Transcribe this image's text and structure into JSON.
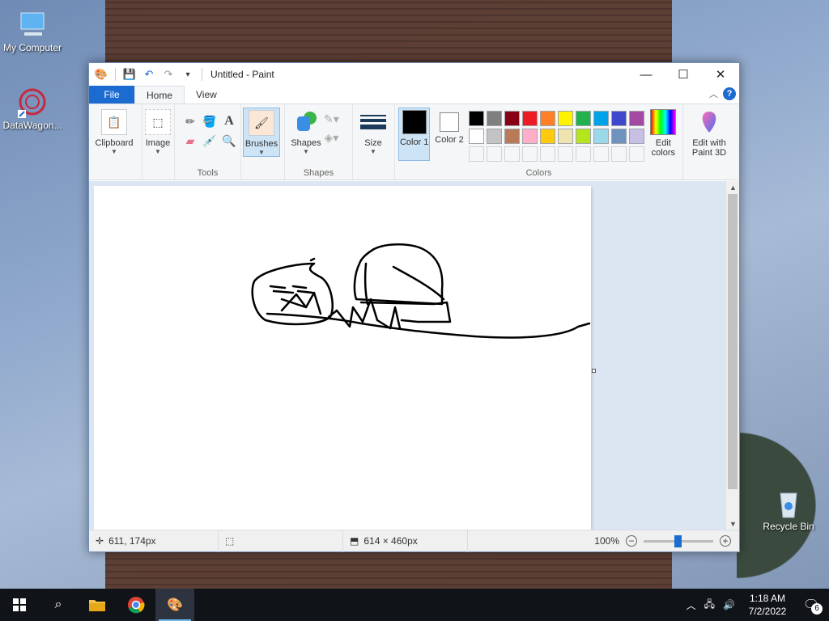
{
  "desktop": {
    "icons": [
      {
        "label": "My Computer"
      },
      {
        "label": "DataWagon..."
      },
      {
        "label": "Recycle Bin"
      }
    ]
  },
  "window": {
    "title": "Untitled - Paint",
    "controls": {
      "minimize": "—",
      "maximize": "☐",
      "close": "✕"
    }
  },
  "tabs": {
    "file": "File",
    "home": "Home",
    "view": "View"
  },
  "ribbon": {
    "clipboard": "Clipboard",
    "image": "Image",
    "tools_label": "Tools",
    "brushes": "Brushes",
    "shapes": "Shapes",
    "shapes_label": "Shapes",
    "size": "Size",
    "color1": "Color 1",
    "color2": "Color 2",
    "colors_label": "Colors",
    "edit_colors": "Edit colors",
    "edit_paint3d": "Edit with Paint 3D"
  },
  "palette": [
    "#000000",
    "#7f7f7f",
    "#880015",
    "#ed1c24",
    "#ff7f27",
    "#fff200",
    "#22b14c",
    "#00a2e8",
    "#3f48cc",
    "#a349a4",
    "#ffffff",
    "#c3c3c3",
    "#b97a57",
    "#ffaec9",
    "#ffc90e",
    "#efe4b0",
    "#b5e61d",
    "#99d9ea",
    "#7092be",
    "#c8bfe7"
  ],
  "status": {
    "cursor": "611, 174px",
    "size": "614 × 460px",
    "zoom": "100%"
  },
  "taskbar": {
    "time": "1:18 AM",
    "date": "7/2/2022",
    "notifications": "6"
  }
}
